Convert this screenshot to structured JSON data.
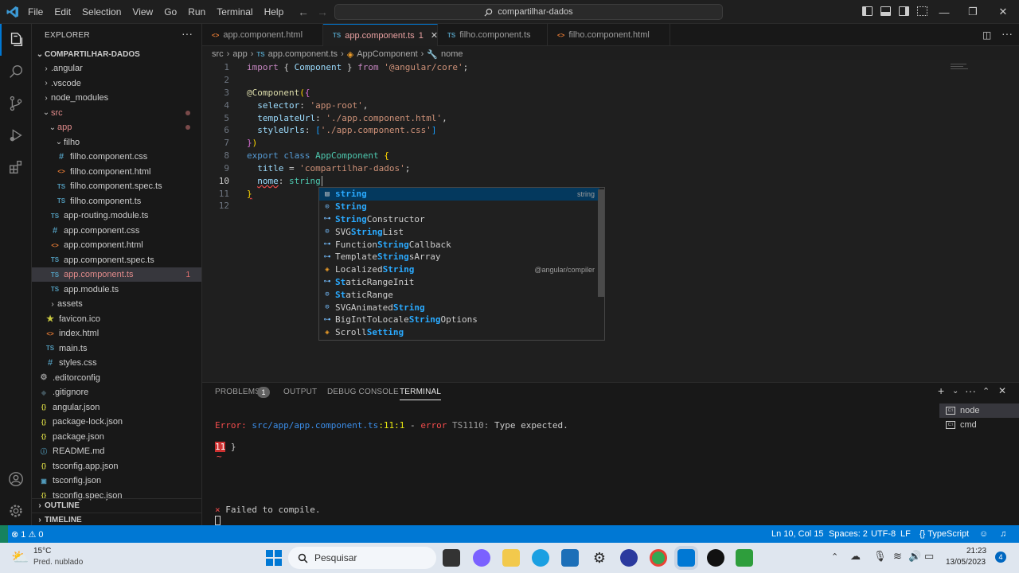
{
  "menu": [
    "File",
    "Edit",
    "Selection",
    "View",
    "Go",
    "Run",
    "Terminal",
    "Help"
  ],
  "command_center": "compartilhar-dados",
  "explorer": {
    "title": "EXPLORER",
    "root": "COMPARTILHAR-DADOS",
    "items": [
      {
        "label": ".angular",
        "type": "folder"
      },
      {
        "label": ".vscode",
        "type": "folder"
      },
      {
        "label": "node_modules",
        "type": "folder"
      },
      {
        "label": "src",
        "type": "folder-open"
      },
      {
        "label": "app",
        "type": "folder-open"
      },
      {
        "label": "filho",
        "type": "folder-open"
      },
      {
        "label": "filho.component.css",
        "type": "css"
      },
      {
        "label": "filho.component.html",
        "type": "html"
      },
      {
        "label": "filho.component.spec.ts",
        "type": "ts"
      },
      {
        "label": "filho.component.ts",
        "type": "ts"
      },
      {
        "label": "app-routing.module.ts",
        "type": "ts"
      },
      {
        "label": "app.component.css",
        "type": "css"
      },
      {
        "label": "app.component.html",
        "type": "html"
      },
      {
        "label": "app.component.spec.ts",
        "type": "ts"
      },
      {
        "label": "app.component.ts",
        "type": "ts",
        "badge": "1"
      },
      {
        "label": "app.module.ts",
        "type": "ts"
      },
      {
        "label": "assets",
        "type": "folder"
      },
      {
        "label": "favicon.ico",
        "type": "ico"
      },
      {
        "label": "index.html",
        "type": "html"
      },
      {
        "label": "main.ts",
        "type": "ts"
      },
      {
        "label": "styles.css",
        "type": "css"
      },
      {
        "label": ".editorconfig",
        "type": "gear"
      },
      {
        "label": ".gitignore",
        "type": "git"
      },
      {
        "label": "angular.json",
        "type": "json"
      },
      {
        "label": "package-lock.json",
        "type": "json"
      },
      {
        "label": "package.json",
        "type": "json"
      },
      {
        "label": "README.md",
        "type": "md"
      },
      {
        "label": "tsconfig.app.json",
        "type": "json"
      },
      {
        "label": "tsconfig.json",
        "type": "json"
      },
      {
        "label": "tsconfig.spec.json",
        "type": "json"
      }
    ],
    "outline": "OUTLINE",
    "timeline": "TIMELINE"
  },
  "tabs": [
    {
      "label": "app.component.html",
      "icon": "<>"
    },
    {
      "label": "app.component.ts",
      "icon": "TS",
      "badge": "1",
      "active": true
    },
    {
      "label": "filho.component.ts",
      "icon": "TS"
    },
    {
      "label": "filho.component.html",
      "icon": "<>"
    }
  ],
  "breadcrumb": [
    "src",
    "app",
    "app.component.ts",
    "AppComponent",
    "nome"
  ],
  "line_numbers": [
    "1",
    "2",
    "3",
    "4",
    "5",
    "6",
    "7",
    "8",
    "9",
    "10",
    "11",
    "12"
  ],
  "code": {
    "l1": [
      "import",
      " { ",
      "Component",
      " } ",
      "from",
      " ",
      "'@angular/core'",
      ";"
    ],
    "l3": [
      "@",
      "Component",
      "(",
      "{"
    ],
    "l4": [
      "  ",
      "selector",
      ": ",
      "'app-root'",
      ","
    ],
    "l5": [
      "  ",
      "templateUrl",
      ": ",
      "'./app.component.html'",
      ","
    ],
    "l6": [
      "  ",
      "styleUrls",
      ": ",
      "[",
      "'./app.component.css'",
      "]"
    ],
    "l7": [
      "}",
      ")"
    ],
    "l8": [
      "export",
      " ",
      "class",
      " ",
      "AppComponent",
      " ",
      "{"
    ],
    "l9": [
      "  ",
      "title",
      " = ",
      "'compartilhar-dados'",
      ";"
    ],
    "l10": [
      "  ",
      "nome",
      ": ",
      "string"
    ],
    "l11": [
      "}"
    ]
  },
  "suggestions": [
    {
      "pre": "",
      "hl": "string",
      "post": "",
      "icon": "kw",
      "detail": "string"
    },
    {
      "pre": "",
      "hl": "String",
      "post": "",
      "icon": "intf"
    },
    {
      "pre": "",
      "hl": "String",
      "post": "Constructor",
      "icon": "intf"
    },
    {
      "pre": "SVG",
      "hl": "String",
      "post": "List",
      "icon": "intf"
    },
    {
      "pre": "Function",
      "hl": "String",
      "post": "Callback",
      "icon": "intf"
    },
    {
      "pre": "Template",
      "hl": "String",
      "post": "sArray",
      "icon": "intf"
    },
    {
      "pre": "Localized",
      "hl": "String",
      "post": "",
      "icon": "cls2",
      "detail": "@angular/compiler"
    },
    {
      "pre": "",
      "hl": "St",
      "post": "aticRangeInit",
      "icon": "intf",
      "extra": [
        [
          "St",
          "aticRangeInit"
        ]
      ]
    },
    {
      "pre": "",
      "hl": "St",
      "post": "aticRange",
      "icon": "intf"
    },
    {
      "pre": "SVGAnimated",
      "hl": "String",
      "post": "",
      "icon": "intf"
    },
    {
      "pre": "BigIntToLocale",
      "hl": "String",
      "post": "Options",
      "icon": "intf"
    },
    {
      "pre": "Scroll",
      "hl": "Setting",
      "post": "",
      "icon": "cls2"
    }
  ],
  "panel": {
    "tabs": [
      "PROBLEMS",
      "OUTPUT",
      "DEBUG CONSOLE",
      "TERMINAL"
    ],
    "problems_badge": "1",
    "terminal": {
      "error_prefix": "Error: ",
      "error_path": "src/app/app.component.ts",
      "error_loc": ":11:1",
      "error_sep": " - ",
      "error_word": "error",
      "error_code": " TS1110:",
      "error_msg": " Type expected.",
      "line_badge": "11",
      "line_text": " }",
      "tilde": "~",
      "fail_mark": "×",
      "fail_msg": " Failed to compile."
    },
    "terminals": [
      "node",
      "cmd"
    ]
  },
  "status": {
    "problems": "⊗ 1 ⚠ 0",
    "position": "Ln 10, Col 15",
    "spaces": "Spaces: 2",
    "encoding": "UTF-8",
    "eol": "LF",
    "language": "{} TypeScript"
  },
  "taskbar": {
    "weather_temp": "15°C",
    "weather_desc": "Pred. nublado",
    "search": "Pesquisar",
    "time": "21:23",
    "date": "13/05/2023",
    "notif": "4"
  }
}
